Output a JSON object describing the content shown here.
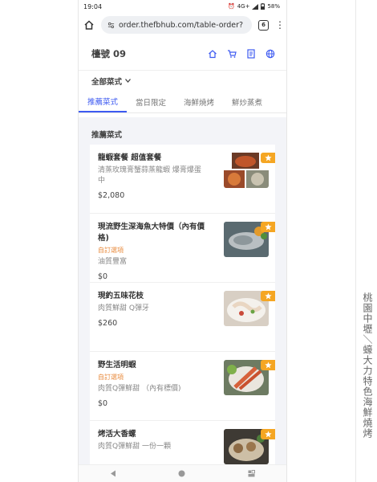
{
  "statusbar": {
    "time": "19:04",
    "signal": "4G+",
    "battery": "58%"
  },
  "browser": {
    "url": "order.thefbhub.com/table-order?",
    "tab_count": "6"
  },
  "header": {
    "title": "檯號 09"
  },
  "category": {
    "label": "全部菜式"
  },
  "tabs": [
    "推薦菜式",
    "當日限定",
    "海鮮燒烤",
    "鮮炒蒸煮"
  ],
  "section": {
    "title": "推薦菜式"
  },
  "items": [
    {
      "name": "龍蝦套餐 超值套餐",
      "tag": "",
      "desc": "清蒸玫瑰膏蟹蒜蒸龍蝦 爆膏爆蛋中",
      "price": "$2,080"
    },
    {
      "name": "現流野生深海魚大特價（內有價格)",
      "tag": "自訂選項",
      "desc": "油質豐富",
      "price": "$0"
    },
    {
      "name": "現釣五味花枝",
      "tag": "",
      "desc": "肉質鮮甜 Q彈牙",
      "price": "$260"
    },
    {
      "name": "野生活明蝦",
      "tag": "自訂選項",
      "desc": "肉質Q彈鮮甜 （內有標價)",
      "price": "$0"
    },
    {
      "name": "烤活大香螺",
      "tag": "",
      "desc": "肉質Q彈鮮甜 一份一顆",
      "price": ""
    }
  ],
  "side_caption": "桃園中壢＼蠔大力特色海鮮燒烤",
  "colors": {
    "accent": "#3d5af1",
    "badge": "#f5a623",
    "tag": "#e88a3c"
  }
}
